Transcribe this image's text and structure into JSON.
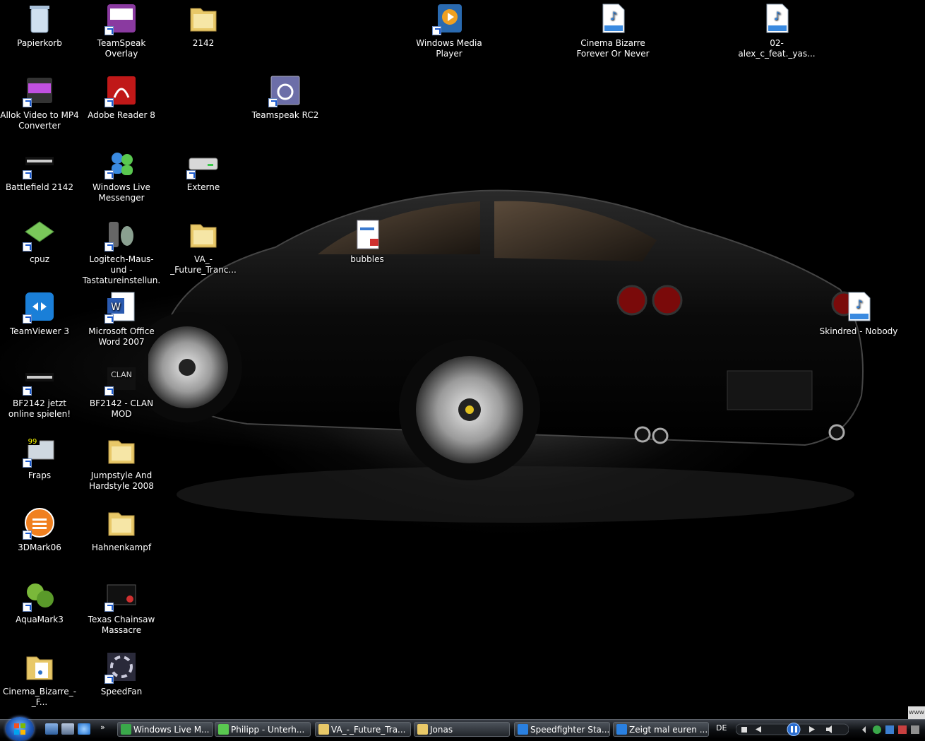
{
  "desktop_icons": [
    {
      "label": "Papierkorb",
      "icon": "recycle-bin-icon"
    },
    {
      "label": "TeamSpeak Overlay",
      "icon": "teamspeak-overlay-icon"
    },
    {
      "label": "2142",
      "icon": "folder-icon"
    },
    {
      "label": "Windows Media Player",
      "icon": "media-player-icon"
    },
    {
      "label": "Cinema Bizarre Forever Or Never",
      "icon": "mp3-icon"
    },
    {
      "label": "02-alex_c_feat._yas...",
      "icon": "mp3-icon"
    },
    {
      "label": "Allok Video to MP4 Converter",
      "icon": "mp4-converter-icon"
    },
    {
      "label": "Adobe Reader 8",
      "icon": "adobe-reader-icon"
    },
    {
      "label": "Teamspeak RC2",
      "icon": "teamspeak-icon"
    },
    {
      "label": "Battlefield 2142",
      "icon": "battlefield-icon"
    },
    {
      "label": "Windows Live Messenger",
      "icon": "messenger-icon"
    },
    {
      "label": "Externe",
      "icon": "drive-icon"
    },
    {
      "label": "cpuz",
      "icon": "chip-icon"
    },
    {
      "label": "Logitech-Maus- und -Tastatureinstellun...",
      "icon": "mouse-keyboard-icon"
    },
    {
      "label": "VA_-_Future_Tranc...",
      "icon": "folder-icon"
    },
    {
      "label": "bubbles",
      "icon": "document-icon"
    },
    {
      "label": "TeamViewer 3",
      "icon": "teamviewer-icon"
    },
    {
      "label": "Microsoft Office Word 2007",
      "icon": "word-icon"
    },
    {
      "label": "Skindred - Nobody",
      "icon": "mp3-icon"
    },
    {
      "label": "BF2142 jetzt online spielen!",
      "icon": "battlefield-icon"
    },
    {
      "label": "BF2142 - CLAN MOD",
      "icon": "clan-icon"
    },
    {
      "label": "Fraps",
      "icon": "fraps-icon"
    },
    {
      "label": "Jumpstyle And Hardstyle 2008",
      "icon": "folder-icon"
    },
    {
      "label": "3DMark06",
      "icon": "3dmark-icon"
    },
    {
      "label": "Hahnenkampf",
      "icon": "folder-icon"
    },
    {
      "label": "AquaMark3",
      "icon": "aquamark-icon"
    },
    {
      "label": "Texas Chainsaw Massacre",
      "icon": "movie-icon"
    },
    {
      "label": "Cinema_Bizarre_-_F...",
      "icon": "music-folder-icon"
    },
    {
      "label": "SpeedFan",
      "icon": "speedfan-icon"
    }
  ],
  "taskbar": {
    "buttons": [
      {
        "label": "Windows Live M...",
        "icon": "messenger-icon"
      },
      {
        "label": "Philipp - Unterh...",
        "icon": "chat-icon"
      },
      {
        "label": "VA_-_Future_Tra...",
        "icon": "folder-icon"
      },
      {
        "label": "Jonas",
        "icon": "folder-icon"
      },
      {
        "label": "Speedfighter Sta...",
        "icon": "ie-icon"
      },
      {
        "label": "Zeigt mal euren ...",
        "icon": "ie-icon"
      }
    ],
    "language": "DE",
    "overflow_chevron": "»",
    "watermark": "www"
  },
  "colors": {
    "taskbar_dark": "#0d0f12",
    "start_orb": "#1d58b8",
    "text": "#ffffff"
  }
}
